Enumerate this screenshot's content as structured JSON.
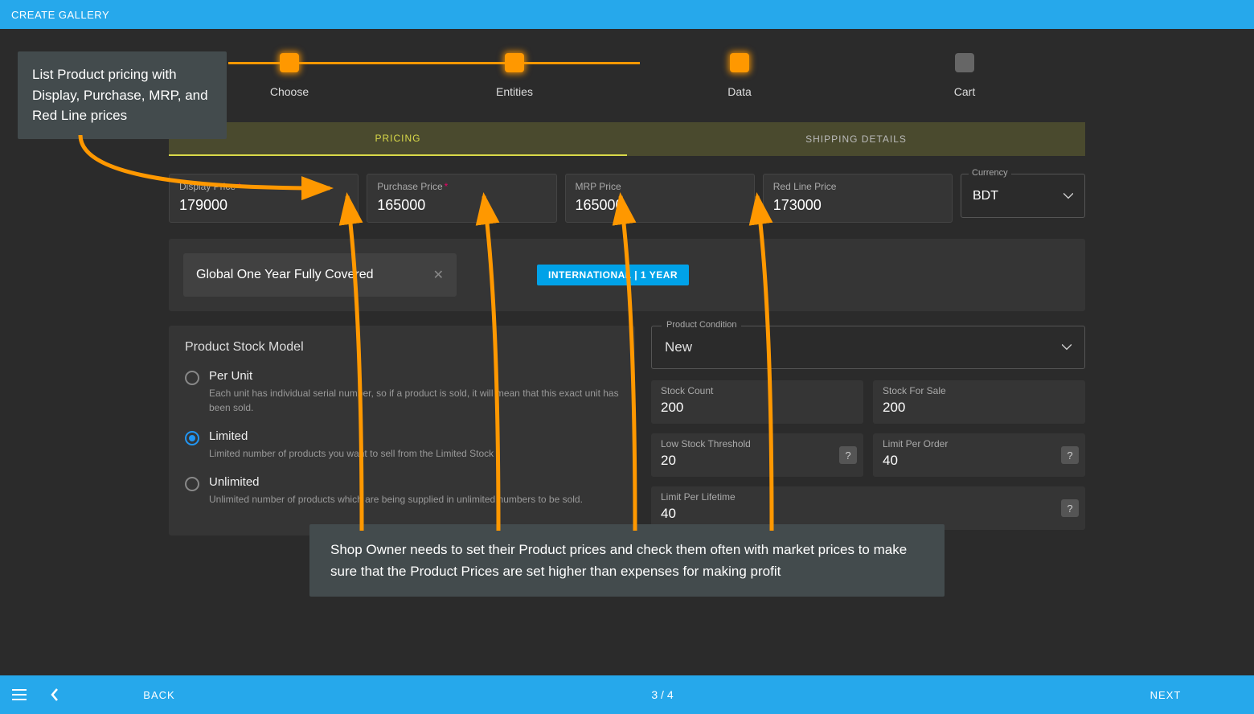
{
  "header": {
    "title": "CREATE GALLERY"
  },
  "steps": [
    {
      "label": "Choose",
      "active": true
    },
    {
      "label": "Entities",
      "active": true
    },
    {
      "label": "Data",
      "active": true
    },
    {
      "label": "Cart",
      "active": false
    }
  ],
  "tabs": {
    "pricing": "PRICING",
    "shipping": "SHIPPING DETAILS"
  },
  "prices": {
    "display": {
      "label": "Display Price",
      "value": "179000",
      "required": true
    },
    "purchase": {
      "label": "Purchase Price",
      "value": "165000",
      "required": true
    },
    "mrp": {
      "label": "MRP Price",
      "value": "165000",
      "required": false
    },
    "redline": {
      "label": "Red Line Price",
      "value": "173000",
      "required": false
    }
  },
  "currency": {
    "label": "Currency",
    "value": "BDT"
  },
  "warranty": {
    "chip": "Global One Year Fully Covered",
    "badge": "INTERNATIONAL | 1 YEAR"
  },
  "stock_model": {
    "title": "Product Stock Model",
    "options": [
      {
        "id": "per-unit",
        "title": "Per Unit",
        "desc": "Each unit has individual serial number, so if a product is sold, it will mean that this exact unit has been sold.",
        "selected": false
      },
      {
        "id": "limited",
        "title": "Limited",
        "desc": "Limited number of products you want to sell from the Limited Stock",
        "selected": true
      },
      {
        "id": "unlimited",
        "title": "Unlimited",
        "desc": "Unlimited number of products which are being supplied in unlimited numbers to be sold.",
        "selected": false
      }
    ]
  },
  "condition": {
    "label": "Product Condition",
    "value": "New"
  },
  "stock_fields": {
    "stock_count": {
      "label": "Stock Count",
      "value": "200"
    },
    "stock_sale": {
      "label": "Stock For Sale",
      "value": "200"
    },
    "low_thresh": {
      "label": "Low Stock Threshold",
      "value": "20",
      "help": true
    },
    "limit_order": {
      "label": "Limit Per Order",
      "value": "40",
      "help": true
    },
    "limit_life": {
      "label": "Limit Per Lifetime",
      "value": "40",
      "help": true
    }
  },
  "footer": {
    "back": "BACK",
    "next": "NEXT",
    "page": "3 / 4"
  },
  "callouts": {
    "c1": "List Product pricing with Display, Purchase, MRP, and Red Line prices",
    "c2": "Shop Owner needs to set their Product prices and check them often with market prices to make sure that the Product Prices are set higher than expenses for making profit"
  }
}
